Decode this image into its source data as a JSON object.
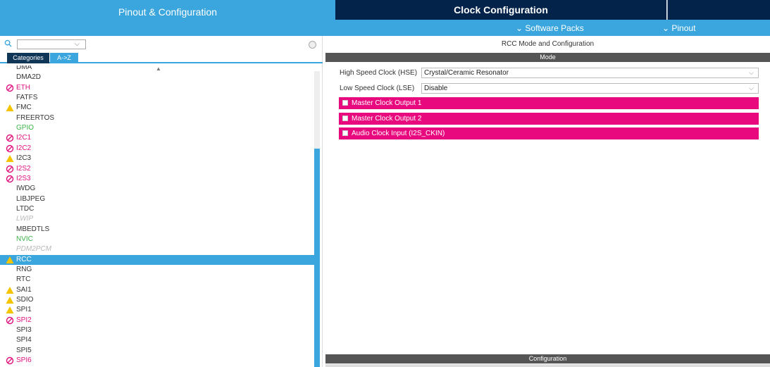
{
  "tabs": {
    "pinout": "Pinout & Configuration",
    "clock": "Clock Configuration"
  },
  "subbar": {
    "software_packs": "⌄ Software Packs",
    "pinout": "⌄ Pinout"
  },
  "left": {
    "search_placeholder": "",
    "tab_categories": "Categories",
    "tab_az": "A->Z",
    "items": [
      {
        "label": "DMA",
        "state": "normal",
        "icon": "none"
      },
      {
        "label": "DMA2D",
        "state": "normal",
        "icon": "none"
      },
      {
        "label": "ETH",
        "state": "error",
        "icon": "blocked-icon"
      },
      {
        "label": "FATFS",
        "state": "normal",
        "icon": "none"
      },
      {
        "label": "FMC",
        "state": "warning",
        "icon": "warning-icon"
      },
      {
        "label": "FREERTOS",
        "state": "normal",
        "icon": "none"
      },
      {
        "label": "GPIO",
        "state": "enabled",
        "icon": "none"
      },
      {
        "label": "I2C1",
        "state": "error",
        "icon": "blocked-icon"
      },
      {
        "label": "I2C2",
        "state": "error",
        "icon": "blocked-icon"
      },
      {
        "label": "I2C3",
        "state": "warning",
        "icon": "warning-icon"
      },
      {
        "label": "I2S2",
        "state": "error",
        "icon": "blocked-icon"
      },
      {
        "label": "I2S3",
        "state": "error",
        "icon": "blocked-icon"
      },
      {
        "label": "IWDG",
        "state": "normal",
        "icon": "none"
      },
      {
        "label": "LIBJPEG",
        "state": "normal",
        "icon": "none"
      },
      {
        "label": "LTDC",
        "state": "normal",
        "icon": "none"
      },
      {
        "label": "LWIP",
        "state": "disabled",
        "icon": "none"
      },
      {
        "label": "MBEDTLS",
        "state": "normal",
        "icon": "none"
      },
      {
        "label": "NVIC",
        "state": "enabled",
        "icon": "none"
      },
      {
        "label": "PDM2PCM",
        "state": "disabled",
        "icon": "none"
      },
      {
        "label": "RCC",
        "state": "selected",
        "icon": "warning-icon"
      },
      {
        "label": "RNG",
        "state": "normal",
        "icon": "none"
      },
      {
        "label": "RTC",
        "state": "normal",
        "icon": "none"
      },
      {
        "label": "SAI1",
        "state": "warning",
        "icon": "warning-icon"
      },
      {
        "label": "SDIO",
        "state": "warning",
        "icon": "warning-icon"
      },
      {
        "label": "SPI1",
        "state": "warning",
        "icon": "warning-icon"
      },
      {
        "label": "SPI2",
        "state": "error",
        "icon": "blocked-icon"
      },
      {
        "label": "SPI3",
        "state": "normal",
        "icon": "none"
      },
      {
        "label": "SPI4",
        "state": "normal",
        "icon": "none"
      },
      {
        "label": "SPI5",
        "state": "normal",
        "icon": "none"
      },
      {
        "label": "SPI6",
        "state": "error",
        "icon": "blocked-icon"
      }
    ]
  },
  "right": {
    "title": "RCC Mode and Configuration",
    "mode_header": "Mode",
    "hse_label": "High Speed Clock (HSE)",
    "hse_value": "Crystal/Ceramic Resonator",
    "lse_label": "Low Speed Clock (LSE)",
    "lse_value": "Disable",
    "options": [
      "Master Clock Output 1",
      "Master Clock Output 2",
      "Audio Clock Input (I2S_CKIN)"
    ],
    "config_header": "Configuration"
  },
  "colors": {
    "accent": "#3aa6dd",
    "dark_tab": "#03234b",
    "pink": "#e8097e",
    "warning": "#f5c400",
    "error": "#e0117f",
    "enabled": "#3db34a"
  }
}
